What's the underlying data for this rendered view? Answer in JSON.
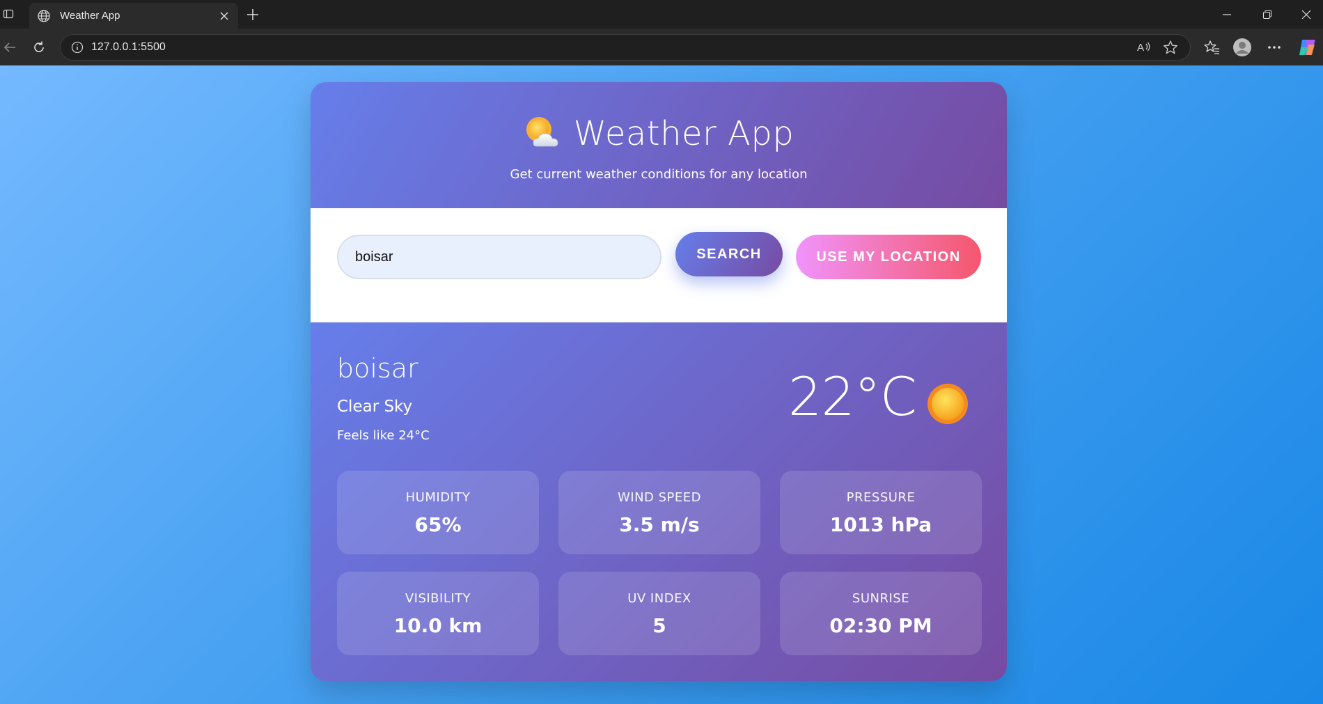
{
  "browser": {
    "tab_title": "Weather App",
    "url": "127.0.0.1:5500"
  },
  "app": {
    "title": "Weather App",
    "subtitle": "Get current weather conditions for any location",
    "icon": "sun-behind-cloud-icon"
  },
  "search": {
    "input_value": "boisar",
    "search_label": "SEARCH",
    "location_label": "USE MY LOCATION"
  },
  "weather": {
    "city": "boisar",
    "condition": "Clear Sky",
    "feels_like": "Feels like 24°C",
    "temperature": "22°C",
    "icon": "sun-icon"
  },
  "details": [
    {
      "label": "HUMIDITY",
      "value": "65%"
    },
    {
      "label": "WIND SPEED",
      "value": "3.5 m/s"
    },
    {
      "label": "PRESSURE",
      "value": "1013 hPa"
    },
    {
      "label": "VISIBILITY",
      "value": "10.0 km"
    },
    {
      "label": "UV INDEX",
      "value": "5"
    },
    {
      "label": "SUNRISE",
      "value": "02:30 PM"
    }
  ],
  "colors": {
    "header_start": "#667eea",
    "header_end": "#764ba2",
    "location_start": "#f093fb",
    "location_end": "#f5576c"
  }
}
